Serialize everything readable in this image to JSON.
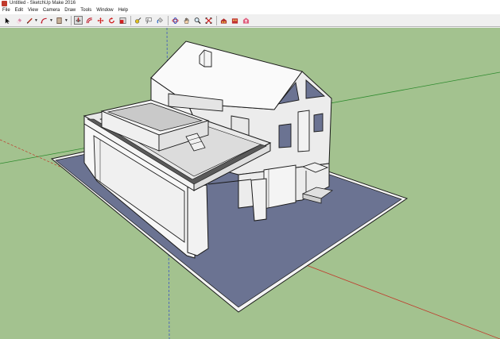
{
  "window": {
    "title": "Untitled - SketchUp Make 2016"
  },
  "menu": [
    "File",
    "Edit",
    "View",
    "Camera",
    "Draw",
    "Tools",
    "Window",
    "Help"
  ],
  "toolbar": {
    "tools": [
      {
        "name": "select-tool-icon"
      },
      {
        "name": "eraser-tool-icon"
      },
      {
        "name": "line-tool-icon"
      },
      {
        "name": "arc-tool-icon"
      },
      {
        "name": "shape-tool-icon"
      },
      {
        "name": "push-pull-tool-icon"
      },
      {
        "name": "offset-tool-icon"
      },
      {
        "name": "move-tool-icon"
      },
      {
        "name": "rotate-tool-icon"
      },
      {
        "name": "scale-tool-icon"
      },
      {
        "name": "tape-measure-tool-icon"
      },
      {
        "name": "text-tool-icon"
      },
      {
        "name": "paint-bucket-tool-icon"
      },
      {
        "name": "orbit-tool-icon"
      },
      {
        "name": "pan-tool-icon"
      },
      {
        "name": "zoom-tool-icon"
      },
      {
        "name": "zoom-extents-tool-icon"
      },
      {
        "name": "warehouse-icon"
      },
      {
        "name": "extension-warehouse-icon"
      },
      {
        "name": "share-model-icon"
      }
    ],
    "active_tool": "push-pull-tool-icon"
  },
  "colors": {
    "ground": "#a3c28f",
    "base_plate": "#6b7392",
    "wall": "#f2f2f2",
    "outline": "#1a1a1a",
    "axis_red": "#c0392b",
    "axis_green": "#2e8b2e",
    "axis_blue": "#3b56c0"
  }
}
